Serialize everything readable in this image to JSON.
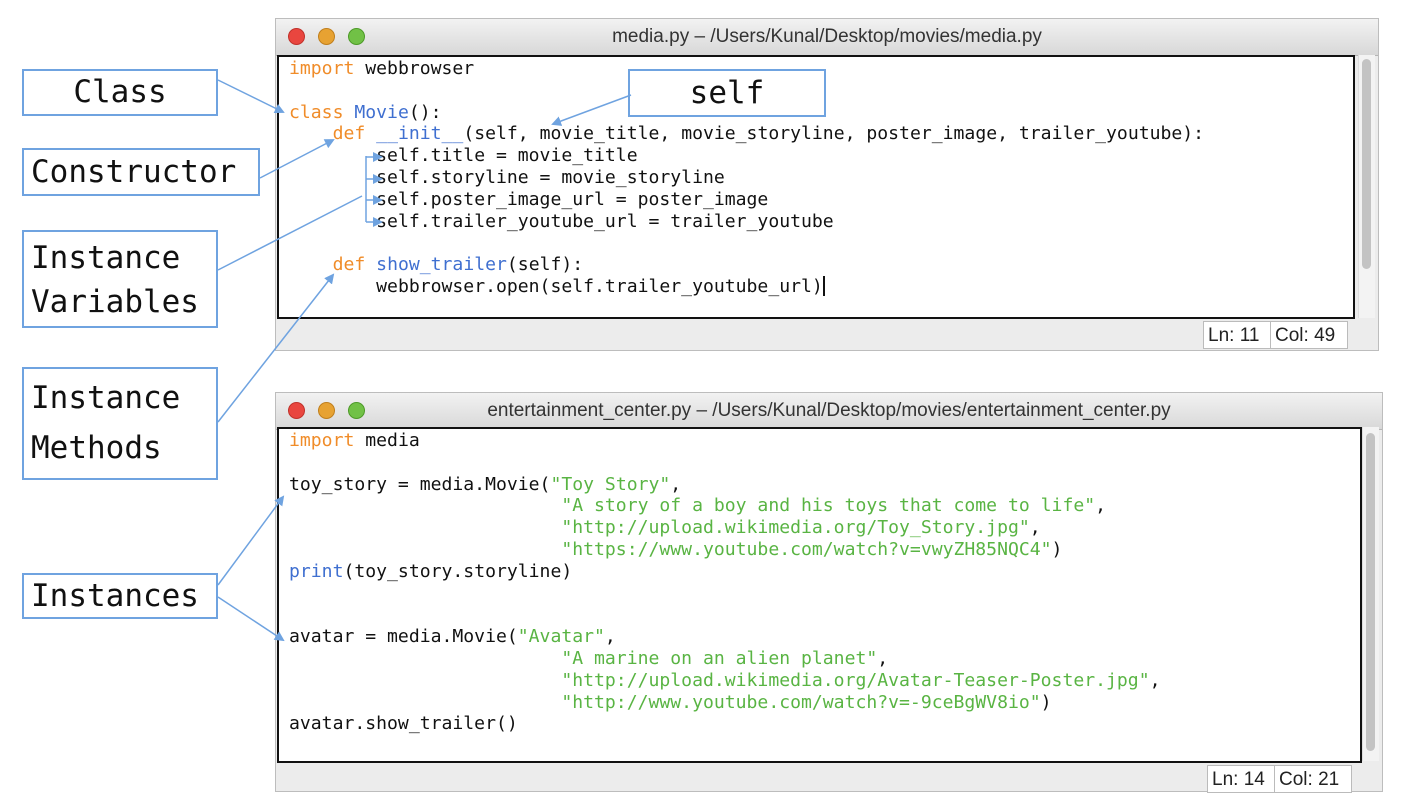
{
  "labels": {
    "class": "Class",
    "constructor": "Constructor",
    "instance_variables_1": "Instance",
    "instance_variables_2": "Variables",
    "instance_methods_1": "Instance",
    "instance_methods_2": "Methods",
    "instances": "Instances",
    "self": "self"
  },
  "window1": {
    "title": "media.py – /Users/Kunal/Desktop/movies/media.py",
    "status_ln": "Ln: 11",
    "status_col": "Col: 49",
    "code": {
      "l1_kw": "import",
      "l1_rest": " webbrowser",
      "l3_kw": "class",
      "l3_name": "Movie",
      "l3_rest": "():",
      "l4_kw": "def",
      "l4_name": "__init__",
      "l4_rest": "(self, movie_title, movie_storyline, poster_image, trailer_youtube):",
      "l5": "self.title = movie_title",
      "l6": "self.storyline = movie_storyline",
      "l7": "self.poster_image_url = poster_image",
      "l8": "self.trailer_youtube_url = trailer_youtube",
      "l10_kw": "def",
      "l10_name": "show_trailer",
      "l10_rest": "(self):",
      "l11": "webbrowser.open(self.trailer_youtube_url)"
    }
  },
  "window2": {
    "title": "entertainment_center.py – /Users/Kunal/Desktop/movies/entertainment_center.py",
    "status_ln": "Ln: 14",
    "status_col": "Col: 21",
    "code": {
      "l1_kw": "import",
      "l1_rest": " media",
      "l3_pre": "toy_story = media.Movie(",
      "l3_str": "\"Toy Story\"",
      "l3_post": ",",
      "l4_str": "\"A story of a boy and his toys that come to life\"",
      "l4_post": ",",
      "l5_str": "\"http://upload.wikimedia.org/Toy_Story.jpg\"",
      "l5_post": ",",
      "l6_str": "\"https://www.youtube.com/watch?v=vwyZH85NQC4\"",
      "l6_post": ")",
      "l7_kw": "print",
      "l7_rest": "(toy_story.storyline)",
      "l10_pre": "avatar = media.Movie(",
      "l10_str": "\"Avatar\"",
      "l10_post": ",",
      "l11_str": "\"A marine on an alien planet\"",
      "l11_post": ",",
      "l12_str": "\"http://upload.wikimedia.org/Avatar-Teaser-Poster.jpg\"",
      "l12_post": ",",
      "l13_str": "\"http://www.youtube.com/watch?v=-9ceBgWV8io\"",
      "l13_post": ")",
      "l14": "avatar.show_trailer()"
    }
  },
  "colors": {
    "keyword": "#f08c29",
    "function_name": "#3f6fd0",
    "string": "#59b443",
    "annotation": "#6fa3e0"
  },
  "icons": [
    "close-light-icon",
    "minimize-light-icon",
    "zoom-light-icon",
    "arrow-icon"
  ]
}
